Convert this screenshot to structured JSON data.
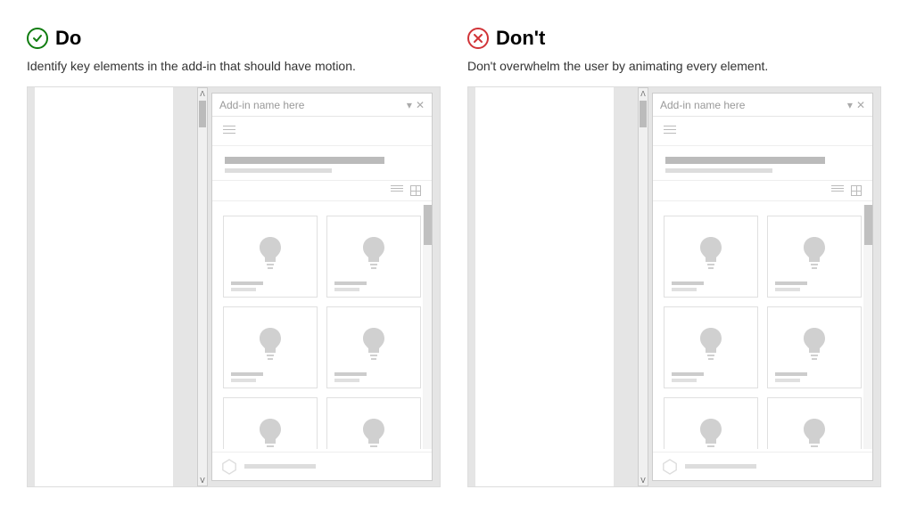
{
  "do": {
    "title": "Do",
    "description": "Identify key elements in the add-in that should have motion."
  },
  "dont": {
    "title": "Don't",
    "description": "Don't overwhelm the user by animating every element."
  },
  "panel": {
    "title": "Add-in name here"
  }
}
